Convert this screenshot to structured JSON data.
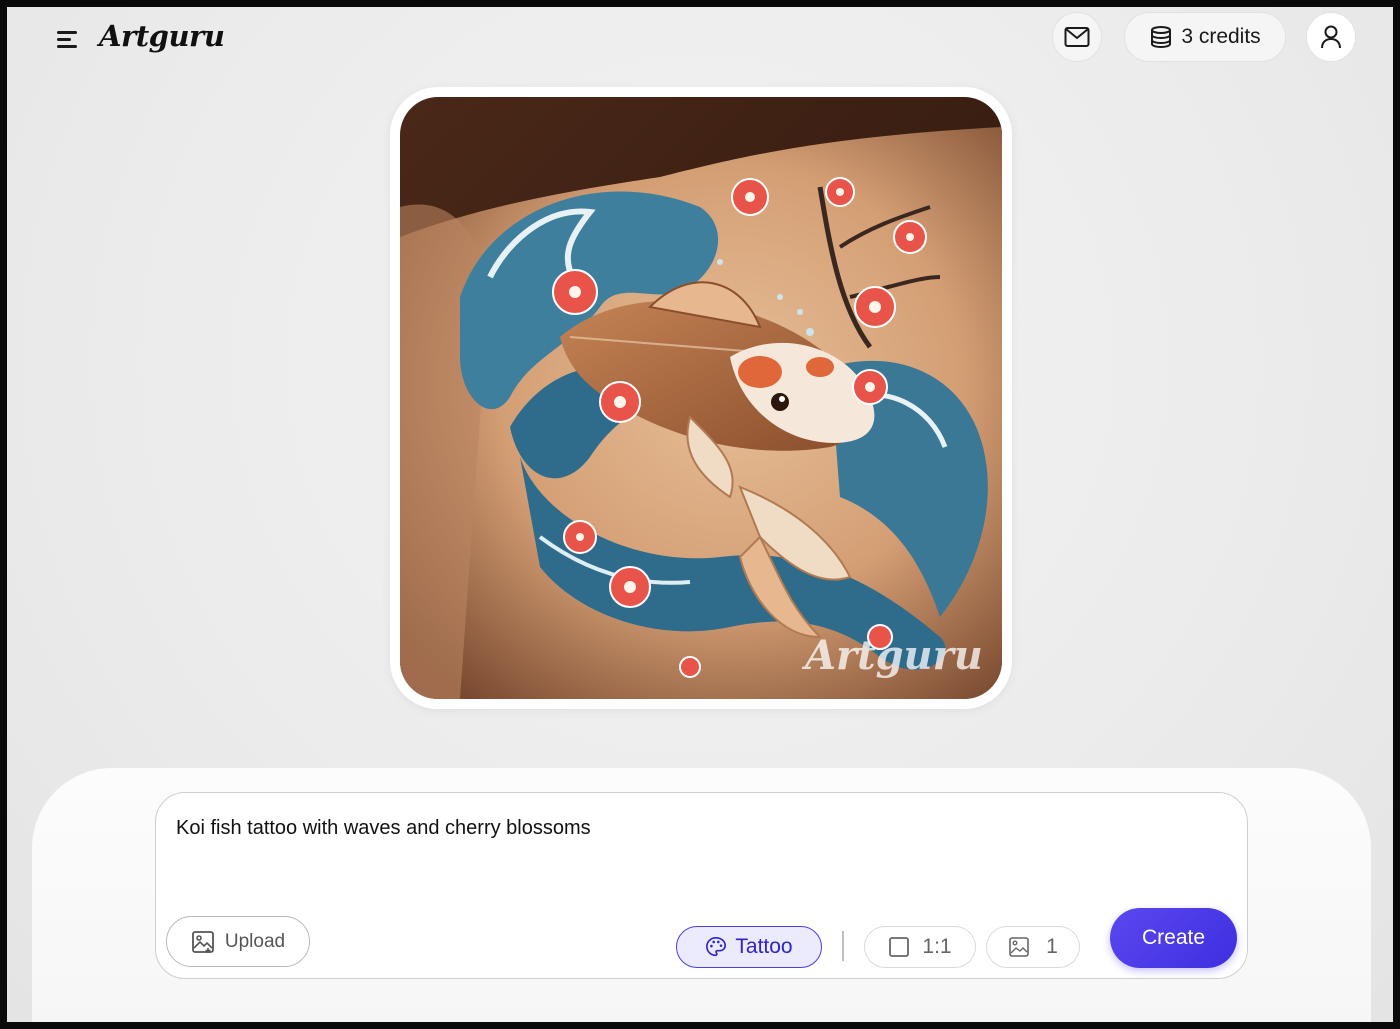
{
  "header": {
    "logo": "Artguru",
    "credits_label": "3 credits"
  },
  "image": {
    "watermark": "Artguru"
  },
  "prompt": {
    "text": "Koi fish tattoo with waves and cherry blossoms"
  },
  "toolbar": {
    "upload_label": "Upload",
    "style_label": "Tattoo",
    "ratio_label": "1:1",
    "count_label": "1",
    "create_label": "Create"
  },
  "colors": {
    "accent": "#4b3ee8",
    "create_button": "#3f2ee0"
  },
  "icons": [
    "menu-icon",
    "mail-icon",
    "coins-icon",
    "user-icon",
    "image-add-icon",
    "palette-icon",
    "square-icon",
    "image-icon"
  ]
}
